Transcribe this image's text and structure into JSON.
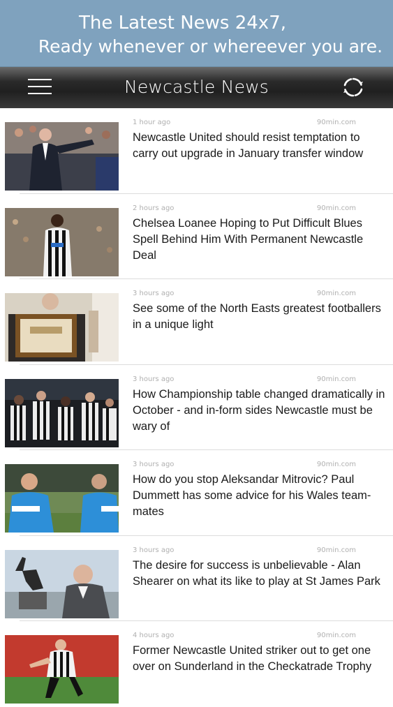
{
  "banner": {
    "line1": "The Latest News 24x7,",
    "line2": "Ready whenever or whereever you are."
  },
  "toolbar": {
    "title": "Newcastle News",
    "menu_icon": "hamburger-menu-icon",
    "refresh_icon": "refresh-icon"
  },
  "articles": [
    {
      "time": "1 hour ago",
      "source": "90min.com",
      "headline": "Newcastle United should resist temptation to carry out upgrade in January transfer window"
    },
    {
      "time": "2 hours ago",
      "source": "90min.com",
      "headline": "Chelsea Loanee Hoping to Put Difficult Blues Spell Behind Him With Permanent Newcastle Deal"
    },
    {
      "time": "3 hours ago",
      "source": "90min.com",
      "headline": "See some of the North Easts greatest footballers in a unique light"
    },
    {
      "time": "3 hours ago",
      "source": "90min.com",
      "headline": "How Championship table changed dramatically in October - and in-form sides Newcastle must be wary of"
    },
    {
      "time": "3 hours ago",
      "source": "90min.com",
      "headline": "How do you stop Aleksandar Mitrovic? Paul Dummett has some advice for his Wales team-mates"
    },
    {
      "time": "3 hours ago",
      "source": "90min.com",
      "headline": "The desire for success is unbelievable - Alan Shearer on what its like to play at St James Park"
    },
    {
      "time": "4 hours ago",
      "source": "90min.com",
      "headline": "Former Newcastle United striker out to get one over on Sunderland in the Checkatrade Trophy"
    }
  ],
  "colors": {
    "banner_bg": "#7fa2be",
    "toolbar_bg": "#2a2a2a",
    "meta_text": "#b0b0b0",
    "headline_text": "#1a1a1a"
  }
}
